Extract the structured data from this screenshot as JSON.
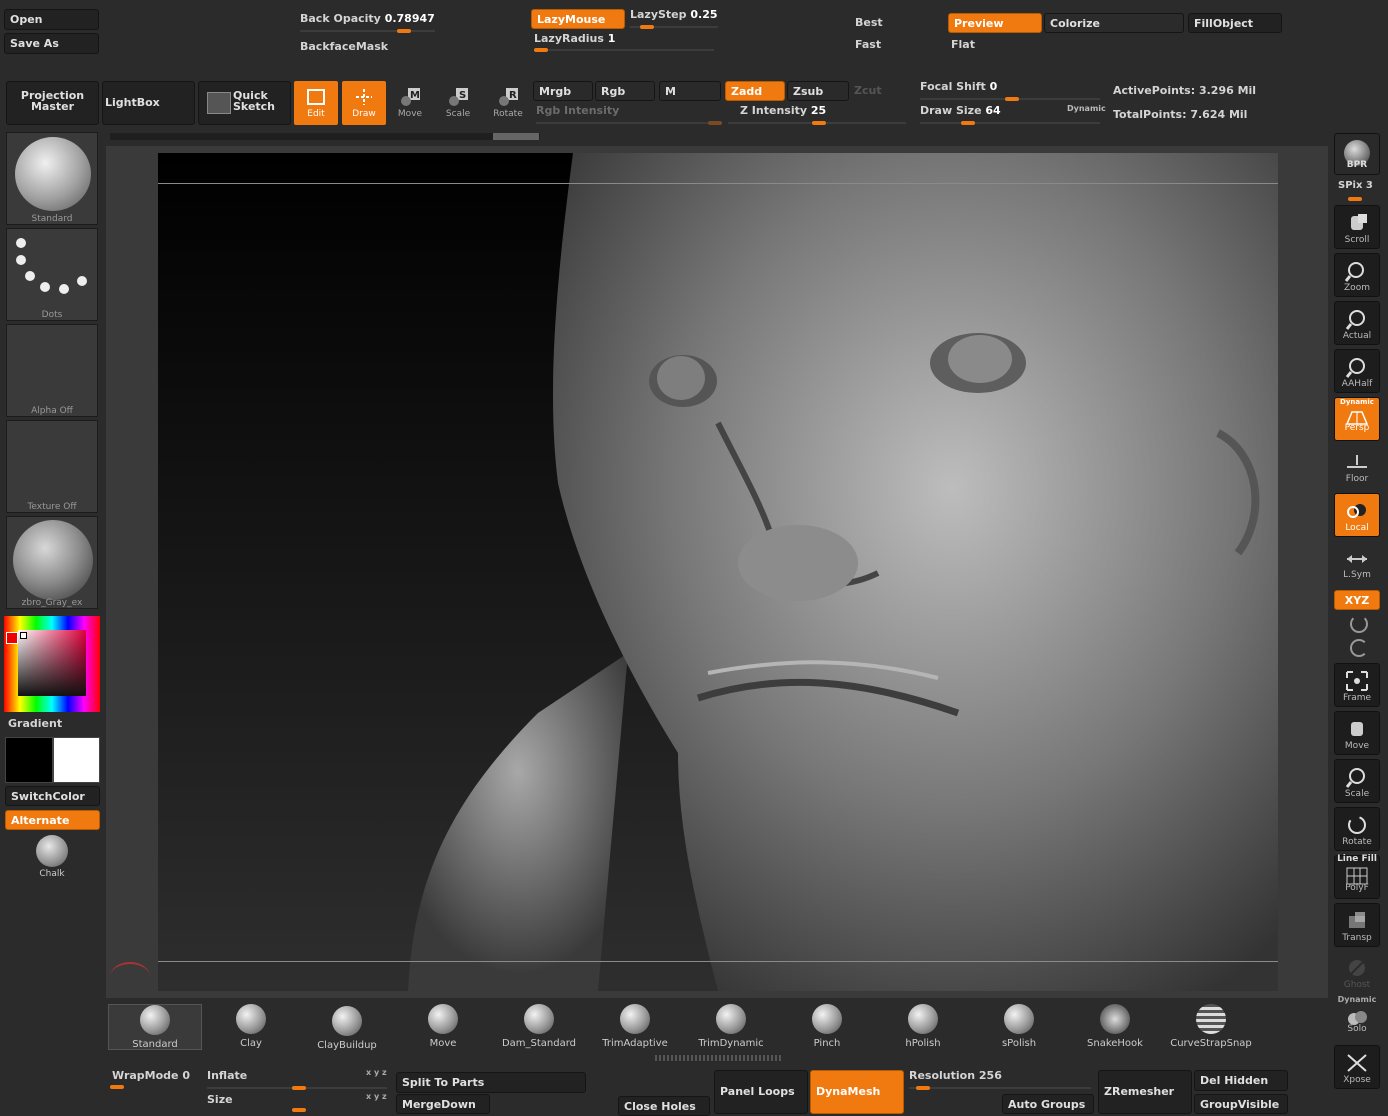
{
  "file": {
    "open": "Open",
    "save_as": "Save As"
  },
  "top": {
    "back_opacity_label": "Back Opacity",
    "back_opacity_value": "0.78947",
    "backface_mask": "BackfaceMask",
    "lazymouse": "LazyMouse",
    "lazystep_label": "LazyStep",
    "lazystep_value": "0.25",
    "lazyradius_label": "LazyRadius",
    "lazyradius_value": "1",
    "best": "Best",
    "fast": "Fast",
    "preview": "Preview",
    "flat": "Flat",
    "colorize": "Colorize",
    "fillobject": "FillObject"
  },
  "toolbar": {
    "projection_master": "Projection Master",
    "lightbox": "LightBox",
    "quick_sketch": "Quick Sketch",
    "edit": "Edit",
    "draw": "Draw",
    "move": "Move",
    "scale": "Scale",
    "rotate": "Rotate",
    "mrgb": "Mrgb",
    "rgb": "Rgb",
    "m": "M",
    "rgb_intensity": "Rgb Intensity",
    "zadd": "Zadd",
    "zsub": "Zsub",
    "zcut": "Zcut",
    "z_intensity_label": "Z Intensity",
    "z_intensity_value": "25",
    "focal_shift_label": "Focal Shift",
    "focal_shift_value": "0",
    "draw_size_label": "Draw Size",
    "draw_size_value": "64",
    "dynamic": "Dynamic",
    "active_points_label": "ActivePoints:",
    "active_points_value": "3.296 Mil",
    "total_points_label": "TotalPoints:",
    "total_points_value": "7.624 Mil"
  },
  "left": {
    "brush_caption": "Standard",
    "stroke_caption": "Dots",
    "alpha_caption": "Alpha  Off",
    "texture_caption": "Texture  Off",
    "material_caption": "zbro_Gray_ex",
    "gradient": "Gradient",
    "switchcolor": "SwitchColor",
    "alternate": "Alternate",
    "chalk": "Chalk"
  },
  "right": {
    "bpr": "BPR",
    "spix_label": "SPix",
    "spix_value": "3",
    "scroll": "Scroll",
    "zoom": "Zoom",
    "actual": "Actual",
    "aahalf": "AAHalf",
    "dynamic": "Dynamic",
    "persp": "Persp",
    "floor": "Floor",
    "local": "Local",
    "lsym": "L.Sym",
    "xyz": "XYZ",
    "frame": "Frame",
    "move": "Move",
    "scale": "Scale",
    "rotate": "Rotate",
    "line_fill": "Line Fill",
    "polyf": "PolyF",
    "transp": "Transp",
    "ghost": "Ghost",
    "dynamic2": "Dynamic",
    "solo": "Solo",
    "xpose": "Xpose"
  },
  "brushes": [
    {
      "label": "Standard"
    },
    {
      "label": "Clay"
    },
    {
      "label": "ClayBuildup"
    },
    {
      "label": "Move"
    },
    {
      "label": "Dam_Standard"
    },
    {
      "label": "TrimAdaptive"
    },
    {
      "label": "TrimDynamic"
    },
    {
      "label": "Pinch"
    },
    {
      "label": "hPolish"
    },
    {
      "label": "sPolish"
    },
    {
      "label": "SnakeHook"
    },
    {
      "label": "CurveStrapSnap"
    }
  ],
  "bottom": {
    "wrapmode_label": "WrapMode",
    "wrapmode_value": "0",
    "inflate": "Inflate",
    "size": "Size",
    "split_to_parts": "Split To Parts",
    "mergedown": "MergeDown",
    "close_holes": "Close Holes",
    "panel_loops": "Panel Loops",
    "dynamesh": "DynaMesh",
    "resolution_label": "Resolution",
    "resolution_value": "256",
    "zremesher": "ZRemesher",
    "del_hidden": "Del Hidden",
    "auto_groups": "Auto Groups",
    "groupvisible": "GroupVisible"
  },
  "colors": {
    "accent": "#f07a10",
    "panel": "#2b2b2b",
    "button": "#222222"
  }
}
